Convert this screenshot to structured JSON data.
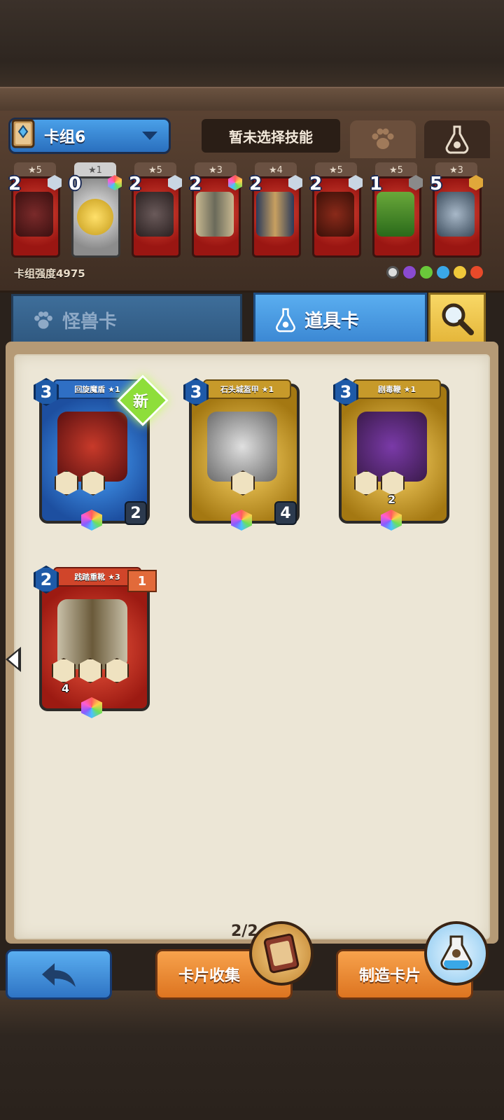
{
  "header": {
    "deck_name": "卡组6",
    "skill_status": "暂未选择技能",
    "deck_strength": "卡组强度4975"
  },
  "deck_cards": [
    {
      "stars": "★5",
      "cost": "2",
      "rarity": "red"
    },
    {
      "stars": "★1",
      "cost": "0",
      "rarity": "gray"
    },
    {
      "stars": "★5",
      "cost": "2",
      "rarity": "red"
    },
    {
      "stars": "★3",
      "cost": "2",
      "rarity": "red"
    },
    {
      "stars": "★4",
      "cost": "2",
      "rarity": "red"
    },
    {
      "stars": "★5",
      "cost": "2",
      "rarity": "red"
    },
    {
      "stars": "★5",
      "cost": "1",
      "rarity": "red"
    },
    {
      "stars": "★3",
      "cost": "5",
      "rarity": "red"
    }
  ],
  "category_tabs": {
    "monster": "怪兽卡",
    "item": "道具卡"
  },
  "item_cards": [
    {
      "name": "回旋魔盾 ★1",
      "cost": "3",
      "attack": "2",
      "color": "blue",
      "new_label": "新"
    },
    {
      "name": "石头城盔甲 ★1",
      "cost": "3",
      "attack": "4",
      "color": "gold"
    },
    {
      "name": "剧毒鞭 ★1",
      "cost": "3",
      "skill_value": "2",
      "color": "gold"
    },
    {
      "name": "践踏重靴 ★3",
      "cost": "2",
      "level": "1",
      "skill_value": "4",
      "color": "red"
    }
  ],
  "pagination": "2/2",
  "bottom_buttons": {
    "collect": "卡片收集",
    "craft": "制造卡片"
  },
  "colors": {
    "blue_tab": "#3a86d2",
    "orange_button": "#dd7420",
    "parchment": "#ece6d6"
  }
}
